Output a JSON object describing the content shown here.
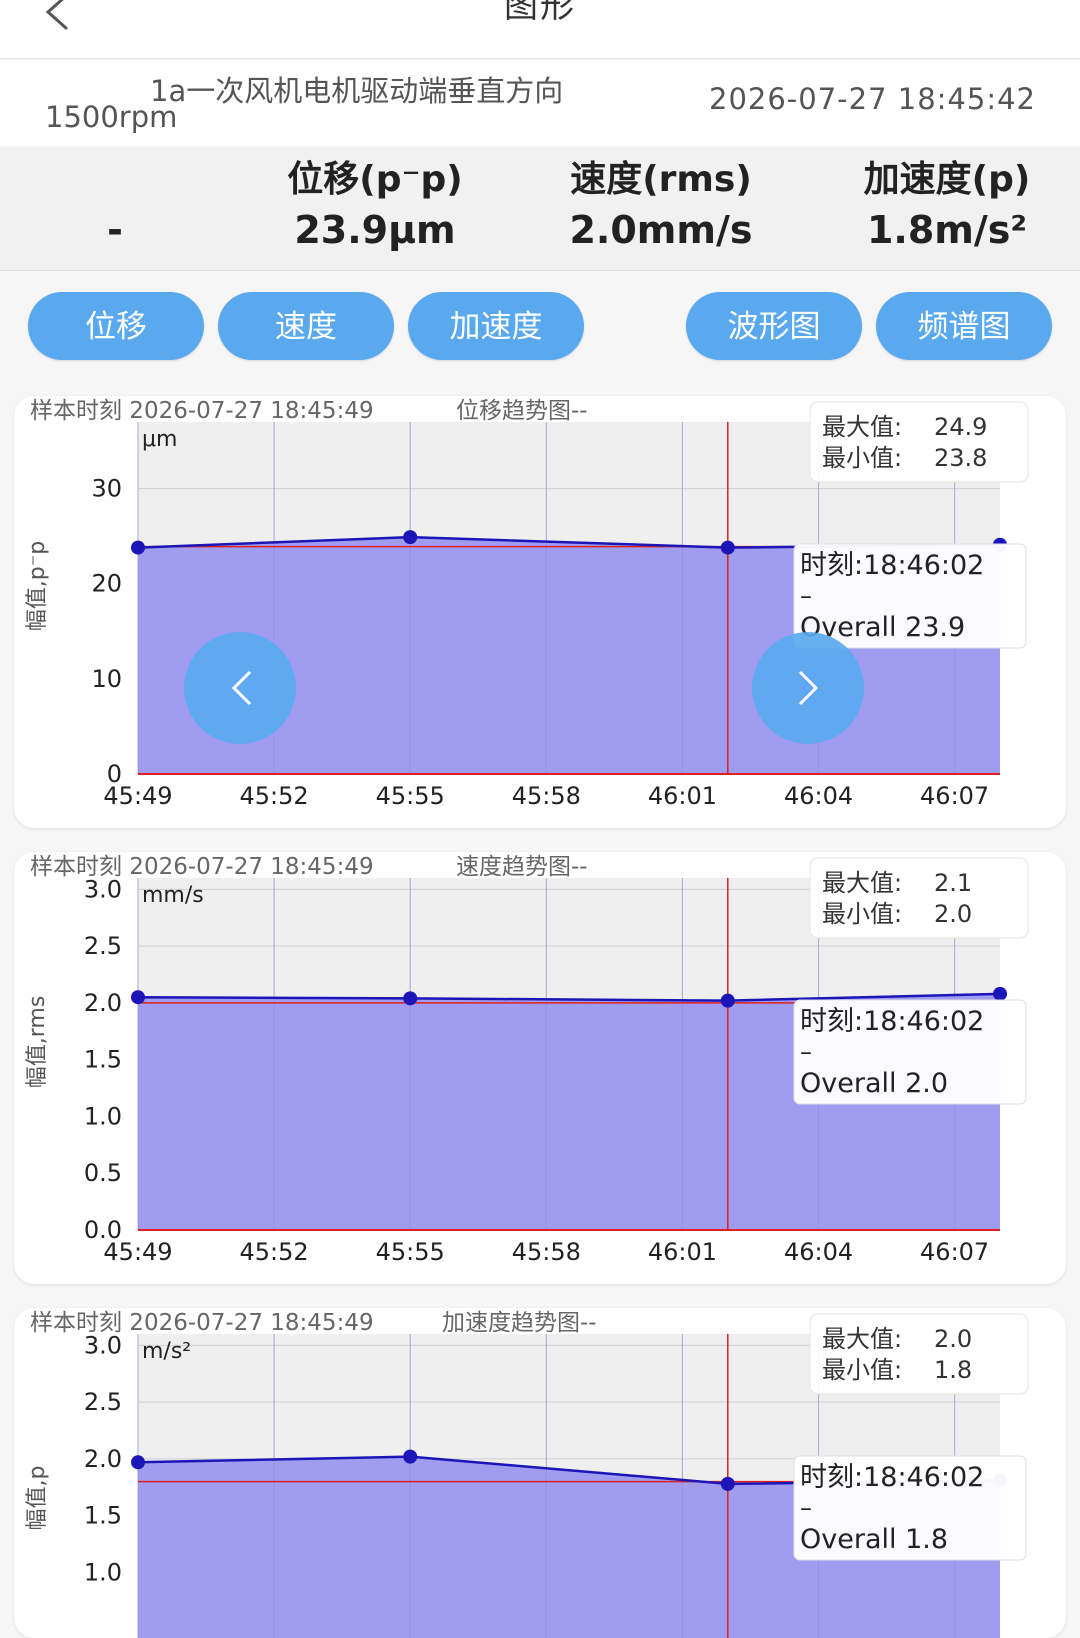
{
  "header": {
    "title": "图形"
  },
  "info": {
    "point": "1a一次风机电机驱动端垂直方向",
    "speed": "1500rpm",
    "time": "2026-07-27 18:45:42"
  },
  "metrics": {
    "first_value": "-",
    "displacement": {
      "label": "位移(p⁻p)",
      "value": "23.9μm"
    },
    "velocity": {
      "label": "速度(rms)",
      "value": "2.0mm/s"
    },
    "acceleration": {
      "label": "加速度(p)",
      "value": "1.8m/s²"
    }
  },
  "buttons": {
    "displacement": "位移",
    "velocity": "速度",
    "acceleration": "加速度",
    "waveform": "波形图",
    "spectrum": "频谱图"
  },
  "colors": {
    "accent": "#5aa9ef",
    "area_fill": "#a09cf0",
    "line": "#1c16b8",
    "cursor": "#e0201e"
  },
  "icons": {
    "prev": "chevron-left-icon",
    "next": "chevron-right-icon",
    "back": "back-arrow-icon"
  },
  "chart_data": [
    {
      "type": "area",
      "header": "样本时刻 2026-07-27 18:45:49",
      "title": "位移趋势图--",
      "unit": "μm",
      "ylabel": "幅值,p⁻p",
      "ylim": [
        0,
        37
      ],
      "yticks": [
        "0",
        "10",
        "20",
        "30"
      ],
      "ytick_values": [
        0,
        10,
        20,
        30
      ],
      "x": [
        "45:49",
        "45:52",
        "45:55",
        "45:58",
        "46:01",
        "46:04",
        "46:07"
      ],
      "point_times": [
        "45:49",
        "45:55",
        "46:02",
        "46:08"
      ],
      "values": [
        23.8,
        24.9,
        23.8,
        24.1
      ],
      "cursor_time": "46:02",
      "cursor_value": 23.9,
      "max_label": "最大值:",
      "max_value": "24.9",
      "min_label": "最小值:",
      "min_value": "23.8",
      "tooltip": {
        "time": "时刻:18:46:02",
        "dash": "–",
        "overall": "Overall 23.9"
      },
      "nav_buttons": true
    },
    {
      "type": "area",
      "header": "样本时刻 2026-07-27 18:45:49",
      "title": "速度趋势图--",
      "unit": "mm/s",
      "ylabel": "幅值,rms",
      "ylim": [
        0,
        3.1
      ],
      "yticks": [
        "0.0",
        "0.5",
        "1.0",
        "1.5",
        "2.0",
        "2.5",
        "3.0"
      ],
      "ytick_values": [
        0,
        0.5,
        1.0,
        1.5,
        2.0,
        2.5,
        3.0
      ],
      "x": [
        "45:49",
        "45:52",
        "45:55",
        "45:58",
        "46:01",
        "46:04",
        "46:07"
      ],
      "point_times": [
        "45:49",
        "45:55",
        "46:02",
        "46:08"
      ],
      "values": [
        2.05,
        2.04,
        2.02,
        2.08
      ],
      "cursor_time": "46:02",
      "cursor_value": 2.0,
      "max_label": "最大值:",
      "max_value": "2.1",
      "min_label": "最小值:",
      "min_value": "2.0",
      "tooltip": {
        "time": "时刻:18:46:02",
        "dash": "–",
        "overall": "Overall 2.0"
      },
      "nav_buttons": false
    },
    {
      "type": "area",
      "header": "样本时刻 2026-07-27 18:45:49",
      "title": "加速度趋势图--",
      "unit": "m/s²",
      "ylabel": "幅值,p",
      "ylim": [
        0,
        3.1
      ],
      "yticks": [
        "1.0",
        "1.5",
        "2.0",
        "2.5",
        "3.0"
      ],
      "ytick_values": [
        1.0,
        1.5,
        2.0,
        2.5,
        3.0
      ],
      "x": [],
      "point_times": [
        "45:49",
        "45:55",
        "46:02",
        "46:08"
      ],
      "values": [
        1.97,
        2.02,
        1.78,
        1.81
      ],
      "cursor_time": "46:02",
      "cursor_value": 1.8,
      "max_label": "最大值:",
      "max_value": "2.0",
      "min_label": "最小值:",
      "min_value": "1.8",
      "tooltip": {
        "time": "时刻:18:46:02",
        "dash": "–",
        "overall": "Overall 1.8"
      },
      "nav_buttons": false
    }
  ]
}
